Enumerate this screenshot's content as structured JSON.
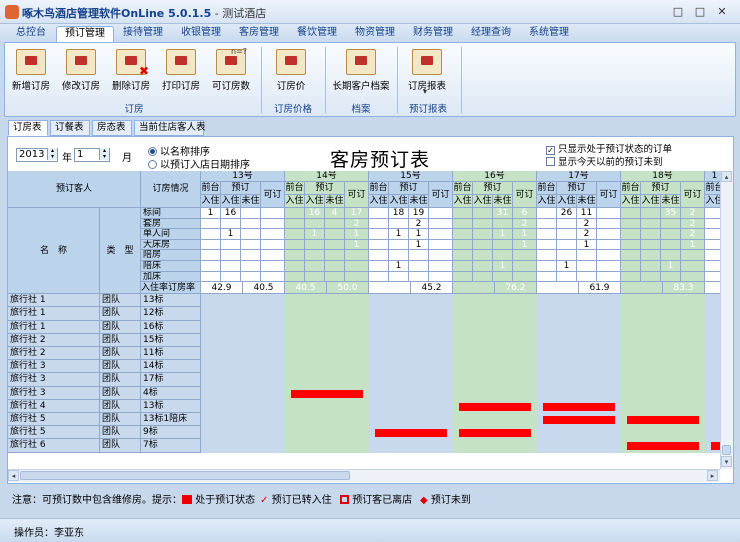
{
  "window": {
    "title": "啄木鸟酒店管理软件OnLine 5.0.1.5",
    "subtitle": " - 测试酒店",
    "minimize": "□",
    "maximize": "□",
    "close": "✕"
  },
  "menu": {
    "tabs": [
      "总控台",
      "预订管理",
      "接待管理",
      "收银管理",
      "客房管理",
      "餐饮管理",
      "物资管理",
      "财务管理",
      "经理查询",
      "系统管理"
    ],
    "active_index": 1
  },
  "ribbon": {
    "buttons": [
      {
        "label": "新增订房",
        "icon": "new-booking-icon"
      },
      {
        "label": "修改订房",
        "icon": "edit-booking-icon"
      },
      {
        "label": "删除订房",
        "icon": "delete-booking-icon"
      },
      {
        "label": "打印订房",
        "icon": "print-booking-icon"
      },
      {
        "label": "可订房数",
        "icon": "available-count-icon"
      },
      {
        "label": "订房价",
        "icon": "room-price-icon"
      },
      {
        "label": "长期客户档案",
        "icon": "customer-archive-icon"
      },
      {
        "label": "订房报表",
        "icon": "booking-report-icon"
      }
    ],
    "groups": [
      "订房",
      "订房价格",
      "档案",
      "预订报表"
    ],
    "dropdown_arrow": "▾"
  },
  "subtabs": [
    "订房表",
    "订餐表",
    "房态表",
    "当前住店客人表"
  ],
  "filters": {
    "year": "2013",
    "year_label": "年",
    "month": "1",
    "month_label": "月",
    "sort_by_name": "以名称排序",
    "sort_by_date": "以预订入店日期排序",
    "only_reserved": "只显示处于预订状态的订单",
    "show_before_today": "显示今天以前的预订未到",
    "check_mark": "✓"
  },
  "page_title": "客房预订表",
  "table": {
    "header_guest": "预订客人",
    "header_booking": "订房情况",
    "header_name": "名　称",
    "header_type": "类　型",
    "room_types": [
      "标间",
      "套房",
      "单人间",
      "大床房",
      "陪房",
      "陪床",
      "加床"
    ],
    "occupancy_label": "入住率订房率",
    "sub_headers": [
      "前台",
      "预订",
      "可订"
    ],
    "sub_headers2": [
      "入住",
      "入住",
      "未住"
    ],
    "days": [
      {
        "day": "13号",
        "shade": false,
        "cells": [
          [
            "1",
            "16",
            "",
            ""
          ],
          [
            "",
            "",
            "",
            ""
          ],
          [
            "",
            "1",
            "",
            ""
          ],
          [
            "",
            "",
            "",
            ""
          ],
          [
            "",
            "",
            "",
            ""
          ],
          [
            "",
            "",
            "",
            ""
          ],
          [
            "",
            "",
            "",
            ""
          ]
        ],
        "rate1": "42.9",
        "rate2": "40.5"
      },
      {
        "day": "14号",
        "shade": true,
        "cells": [
          [
            "",
            "16",
            "4",
            "17"
          ],
          [
            "",
            "",
            "",
            "2"
          ],
          [
            "",
            "1",
            "",
            "1"
          ],
          [
            "",
            "",
            "",
            "1"
          ],
          [
            "",
            "",
            "",
            ""
          ],
          [
            "",
            "",
            "",
            ""
          ],
          [
            "",
            "",
            "",
            ""
          ]
        ],
        "rate1": "40.5",
        "rate2": "50.0"
      },
      {
        "day": "15号",
        "shade": false,
        "cells": [
          [
            "",
            "18",
            "19",
            ""
          ],
          [
            "",
            "",
            "2",
            ""
          ],
          [
            "",
            "1",
            "1",
            ""
          ],
          [
            "",
            "",
            "1",
            ""
          ],
          [
            "",
            "",
            "",
            ""
          ],
          [
            "",
            "1",
            "",
            ""
          ],
          [
            "",
            "",
            "",
            ""
          ]
        ],
        "rate1": "",
        "rate2": "45.2"
      },
      {
        "day": "16号",
        "shade": true,
        "cells": [
          [
            "",
            "",
            "31",
            "6"
          ],
          [
            "",
            "",
            "",
            "2"
          ],
          [
            "",
            "",
            "1",
            "1"
          ],
          [
            "",
            "",
            "",
            "1"
          ],
          [
            "",
            "",
            "",
            ""
          ],
          [
            "",
            "",
            "1",
            ""
          ],
          [
            "",
            "",
            "",
            ""
          ]
        ],
        "rate1": "",
        "rate2": "76.2"
      },
      {
        "day": "17号",
        "shade": false,
        "cells": [
          [
            "",
            "26",
            "11",
            ""
          ],
          [
            "",
            "",
            "2",
            ""
          ],
          [
            "",
            "",
            "2",
            ""
          ],
          [
            "",
            "",
            "1",
            ""
          ],
          [
            "",
            "",
            "",
            ""
          ],
          [
            "",
            "1",
            "",
            ""
          ],
          [
            "",
            "",
            "",
            ""
          ]
        ],
        "rate1": "",
        "rate2": "61.9"
      },
      {
        "day": "18号",
        "shade": true,
        "cells": [
          [
            "",
            "",
            "35",
            "2"
          ],
          [
            "",
            "",
            "",
            "2"
          ],
          [
            "",
            "",
            "",
            "2"
          ],
          [
            "",
            "",
            "",
            "1"
          ],
          [
            "",
            "",
            "",
            ""
          ],
          [
            "",
            "",
            "1",
            ""
          ],
          [
            "",
            "",
            "",
            ""
          ]
        ],
        "rate1": "",
        "rate2": "83.3"
      }
    ],
    "next_day_fragment": "1",
    "next_day_sub": "前台",
    "next_day_sub2": "入住",
    "rows": [
      {
        "name": "旅行社 1",
        "type": "团队",
        "room": "13标",
        "bars": []
      },
      {
        "name": "旅行社 1",
        "type": "团队",
        "room": "12标",
        "bars": []
      },
      {
        "name": "旅行社 1",
        "type": "团队",
        "room": "16标",
        "bars": []
      },
      {
        "name": "旅行社 2",
        "type": "团队",
        "room": "15标",
        "bars": []
      },
      {
        "name": "旅行社 2",
        "type": "团队",
        "room": "11标",
        "bars": []
      },
      {
        "name": "旅行社 3",
        "type": "团队",
        "room": "14标",
        "bars": []
      },
      {
        "name": "旅行社 3",
        "type": "团队",
        "room": "17标",
        "bars": []
      },
      {
        "name": "旅行社 3",
        "type": "团队",
        "room": "4标",
        "bars": [
          [
            1,
            1
          ]
        ]
      },
      {
        "name": "旅行社 4",
        "type": "团队",
        "room": "13标",
        "bars": [
          [
            3,
            3
          ],
          [
            4,
            4
          ]
        ]
      },
      {
        "name": "旅行社 5",
        "type": "团队",
        "room": "13标1陪床",
        "bars": [
          [
            4,
            4
          ],
          [
            5,
            5
          ]
        ]
      },
      {
        "name": "旅行社 5",
        "type": "团队",
        "room": "9标",
        "bars": [
          [
            2,
            2
          ],
          [
            3,
            3
          ]
        ]
      },
      {
        "name": "旅行社 6",
        "type": "团队",
        "room": "7标",
        "bars": [
          [
            5,
            5
          ]
        ]
      }
    ]
  },
  "legend": {
    "note": "注意：可预订数中包含维修房。",
    "hint": "提示：",
    "reserved": "处于预订状态",
    "checked_in": "预订已转入住",
    "left": "预订客已离店",
    "not_arrived": "预订未到",
    "checked_symbol": "✓",
    "not_arrived_symbol": "◆"
  },
  "scroll_arrows": {
    "left": "◂",
    "right": "▸",
    "up": "▴",
    "down": "▾"
  },
  "status": {
    "operator": "操作员：李亚东"
  },
  "colors": {
    "shade": "#c6e2c6",
    "header": "#bcd3ec",
    "body": "#c8d9ee",
    "bar": "#ff0000"
  }
}
